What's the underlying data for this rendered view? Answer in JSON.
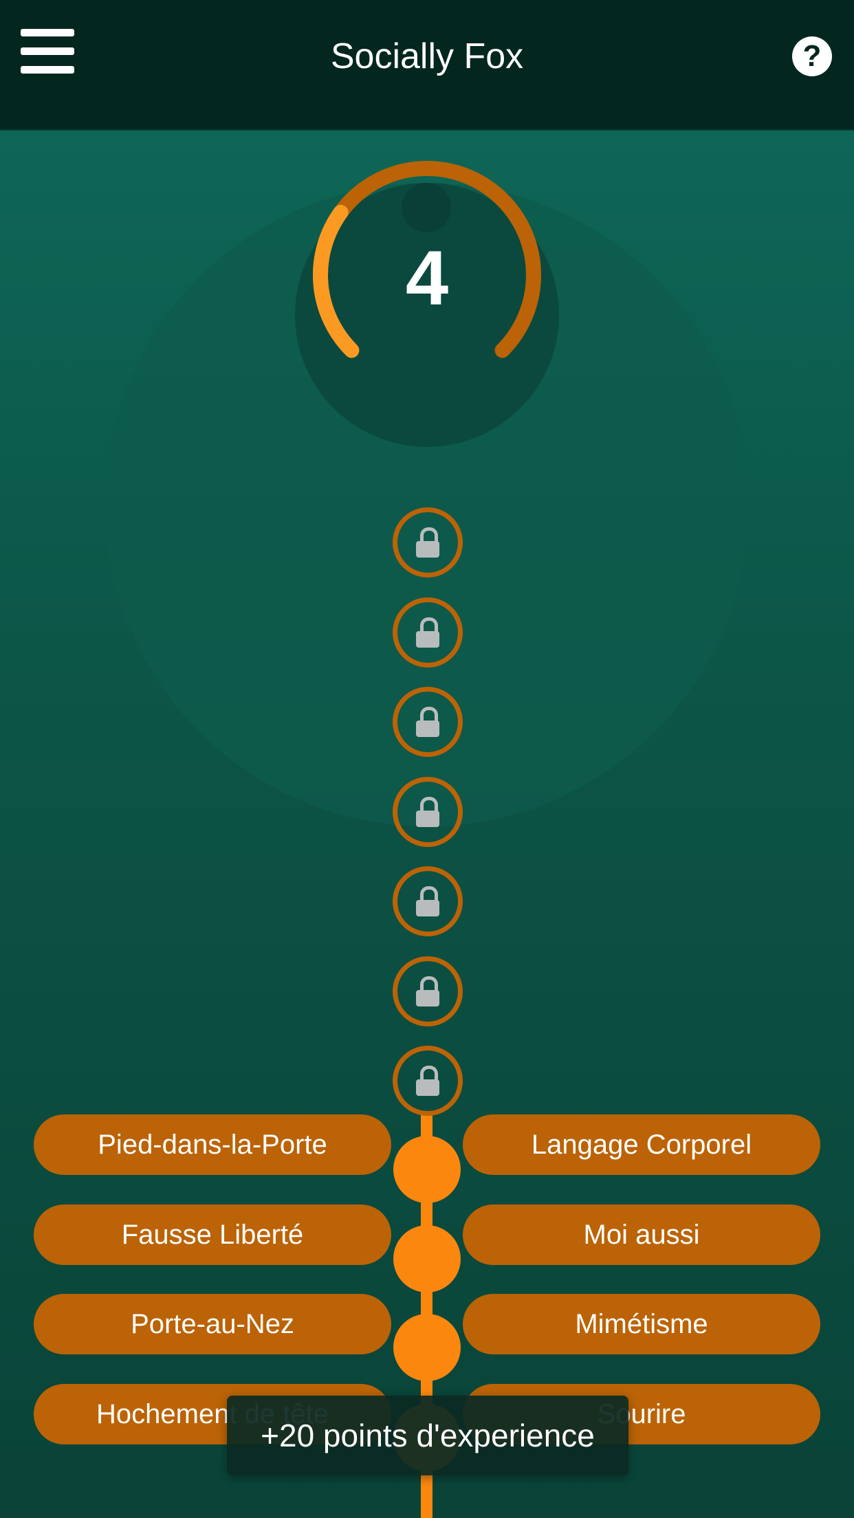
{
  "header": {
    "title": "Socially Fox",
    "help_label": "?"
  },
  "level": {
    "number": "4",
    "progress_fraction": 0.3
  },
  "locked_skill_count": 7,
  "skills": {
    "left": [
      "Pied-dans-la-Porte",
      "Fausse Liberté",
      "Porte-au-Nez",
      "Hochement de tête"
    ],
    "right": [
      "Langage Corporel",
      "Moi aussi",
      "Mimétisme",
      "Sourire"
    ]
  },
  "toast": {
    "message": "+20 points d'experience"
  },
  "colors": {
    "accent": "#fb870f",
    "accent_dark": "#bb6306",
    "header_bg": "#03261f",
    "lock_gray": "#b9bcbd"
  }
}
